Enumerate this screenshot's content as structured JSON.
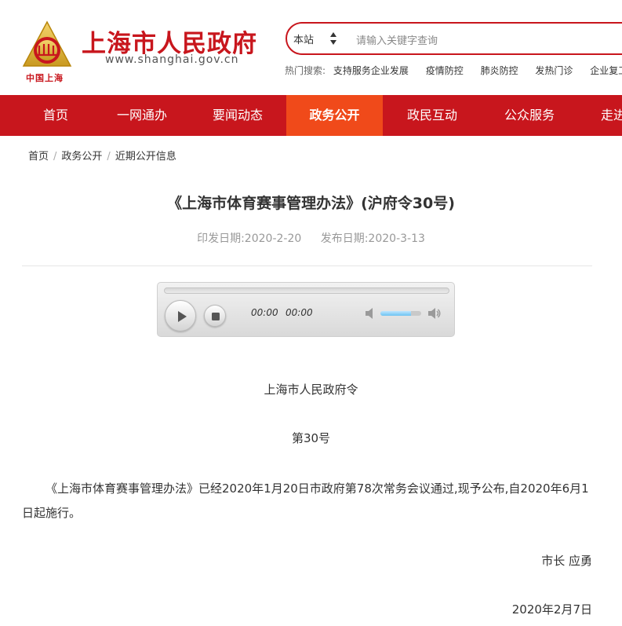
{
  "header": {
    "site_name": "上海市人民政府",
    "site_url": "www.shanghai.gov.cn",
    "logo_text": "中国上海",
    "search": {
      "scope": "本站",
      "placeholder": "请输入关键字查询"
    },
    "hot_search": {
      "label": "热门搜索:",
      "items": [
        "支持服务企业发展",
        "疫情防控",
        "肺炎防控",
        "发热门诊",
        "企业复工"
      ]
    }
  },
  "nav": {
    "items": [
      "首页",
      "一网通办",
      "要闻动态",
      "政务公开",
      "政民互动",
      "公众服务",
      "走进"
    ],
    "active": "政务公开"
  },
  "breadcrumb": [
    "首页",
    "政务公开",
    "近期公开信息"
  ],
  "article": {
    "title": "《上海市体育赛事管理办法》(沪府令30号)",
    "issue_date_label": "印发日期:2020-2-20",
    "publish_date_label": "发布日期:2020-3-13",
    "player": {
      "current_time": "00:00",
      "duration": "00:00",
      "volume": 0.75
    },
    "order_issuer": "上海市人民政府令",
    "order_number": "第30号",
    "body": "《上海市体育赛事管理办法》已经2020年1月20日市政府第78次常务会议通过,现予公布,自2020年6月1日起施行。",
    "signature": "市长 应勇",
    "sign_date": "2020年2月7日"
  },
  "colors": {
    "brand_red": "#c8161d",
    "active_tab": "#f04a1a"
  }
}
